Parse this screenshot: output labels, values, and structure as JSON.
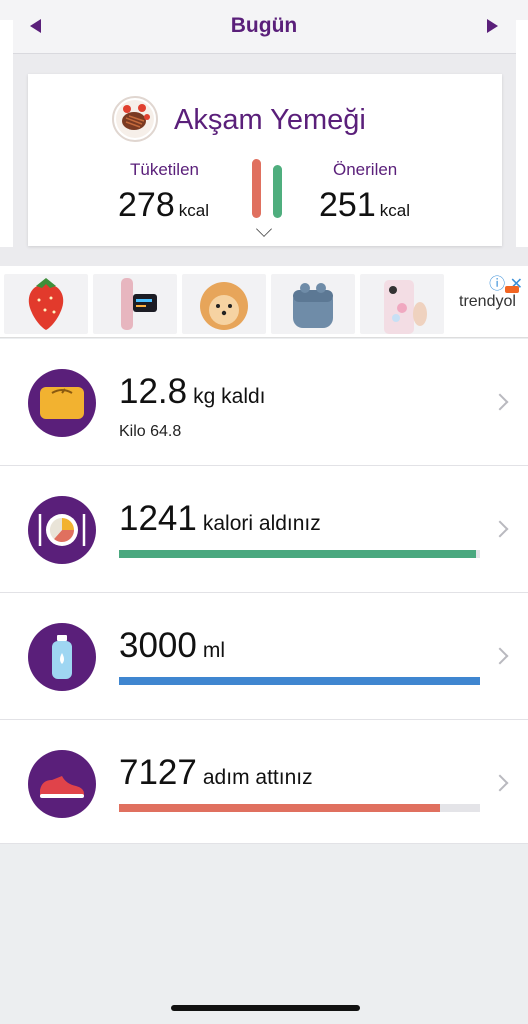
{
  "header": {
    "title": "Bugün"
  },
  "meal": {
    "title": "Akşam Yemeği",
    "consumed_label": "Tüketilen",
    "consumed_value": "278",
    "recommended_label": "Önerilen",
    "recommended_value": "251",
    "unit": "kcal"
  },
  "ad": {
    "brand": "trendyol",
    "items": [
      "strawberry-case",
      "smart-band",
      "pomeranian-dog",
      "wireless-earbuds",
      "phone-case"
    ]
  },
  "rows": [
    {
      "value": "12.8",
      "word": "kg kaldı",
      "sub": "Kilo 64.8"
    },
    {
      "value": "1241",
      "word": "kalori aldınız",
      "progress": 0.99,
      "color": "#4aa87f"
    },
    {
      "value": "3000",
      "word": "ml",
      "progress": 1.0,
      "color": "#3f86d0"
    },
    {
      "value": "7127",
      "word": "adım attınız",
      "progress": 0.89,
      "color": "#e0705f"
    }
  ],
  "colors": {
    "accent": "#5a1f7a"
  }
}
